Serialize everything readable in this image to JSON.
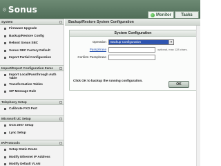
{
  "header": {
    "logo_text": "Sonus",
    "tabs": [
      {
        "label": "Monitor"
      },
      {
        "label": "Tasks"
      }
    ]
  },
  "sidebar": {
    "sections": [
      {
        "title": "System",
        "items": [
          {
            "label": "Firmware Upgrade"
          },
          {
            "label": "Backup/Restore Config"
          },
          {
            "label": "Reboot Sonus SBC"
          },
          {
            "label": "Sonus SBC Factory Default"
          },
          {
            "label": "Import Partial Configuration"
          }
        ]
      },
      {
        "title": "Import/Export Configuration Items",
        "items": [
          {
            "label": "Import Local/Passthrough Auth Table",
            "double": true
          },
          {
            "label": "Transformation Tables"
          },
          {
            "label": "SIP Message Rule"
          }
        ]
      },
      {
        "title": "Telephony Setup",
        "items": [
          {
            "label": "Calibrate FXO Port"
          }
        ]
      },
      {
        "title": "Microsoft UC Setup",
        "items": [
          {
            "label": "OCS 2007 Setup"
          },
          {
            "label": "Lync Setup"
          }
        ]
      },
      {
        "title": "IP/Protocols",
        "items": [
          {
            "label": "Setup Static Route"
          },
          {
            "label": "Modify Ethernet IP Address"
          },
          {
            "label": "Modify Default VLAN"
          }
        ]
      }
    ]
  },
  "main": {
    "title": "Backup/Restore System Configuration",
    "panel_title": "System Configuration",
    "operation_label": "Operation",
    "operation_value": "Backup Configuration",
    "passphrase_label": "Passphrase",
    "passphrase_hint": "optional, max 128 chars.",
    "confirm_label": "Confirm Passphrase",
    "note": "Click OK to backup the running configuration.",
    "ok_label": "OK"
  },
  "colors": {
    "header": "#5f7d67",
    "select_highlight": "#2f55b0",
    "link": "#2a55b0"
  }
}
